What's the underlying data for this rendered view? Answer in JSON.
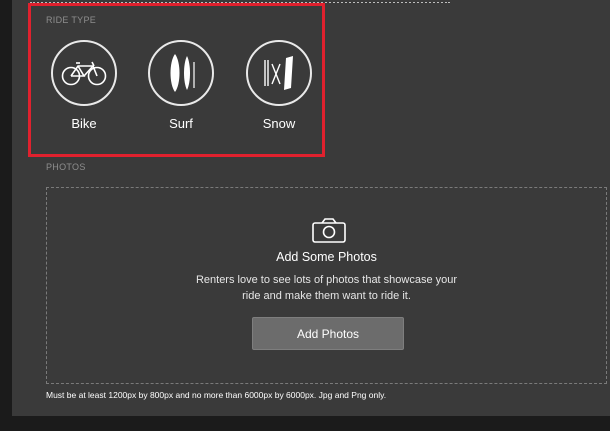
{
  "ride_type": {
    "label": "RIDE TYPE",
    "options": [
      {
        "label": "Bike",
        "icon": "bike-icon"
      },
      {
        "label": "Surf",
        "icon": "surfboard-icon"
      },
      {
        "label": "Snow",
        "icon": "ski-icon"
      }
    ],
    "highlight_color": "#e0212e"
  },
  "photos": {
    "label": "PHOTOS",
    "icon": "camera-icon",
    "title": "Add Some Photos",
    "description_line1": "Renters love to see lots of photos that showcase your",
    "description_line2": "ride and make them want to ride it.",
    "button_label": "Add Photos",
    "note": "Must be at least 1200px by 800px and no more than 6000px by 6000px. Jpg and Png only."
  }
}
